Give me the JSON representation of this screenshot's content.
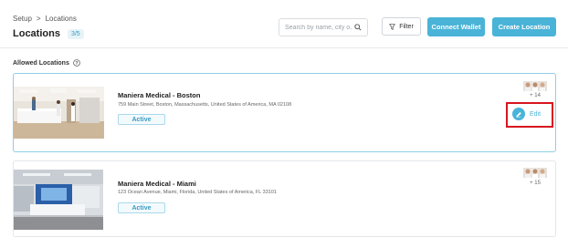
{
  "breadcrumb": {
    "parent": "Setup",
    "separator": ">",
    "current": "Locations"
  },
  "header": {
    "title": "Locations",
    "count_badge": "3/5"
  },
  "search": {
    "placeholder": "Search by name, city o..."
  },
  "toolbar": {
    "filter_label": "Filter",
    "wallet_label": "Connect Wallet",
    "create_label": "Create Location"
  },
  "section": {
    "label": "Allowed Locations"
  },
  "locations": [
    {
      "name": "Maniera Medical - Boston",
      "address": "759 Main Street, Boston, Massachusetts, United States of America, MA 02108",
      "status": "Active",
      "more_count": "+ 14",
      "edit_label": "Edit"
    },
    {
      "name": "Maniera Medical - Miami",
      "address": "123 Ocean Avenue, Miami, Florida, United States of America, FL 33101",
      "status": "Active",
      "more_count": "+ 15"
    }
  ],
  "colors": {
    "accent": "#4ab3d8",
    "highlight": "#d9151f",
    "selected_border": "#8fcfe7"
  },
  "icons": [
    "search-icon",
    "filter-icon",
    "help-icon",
    "pencil-icon",
    "avatar"
  ]
}
